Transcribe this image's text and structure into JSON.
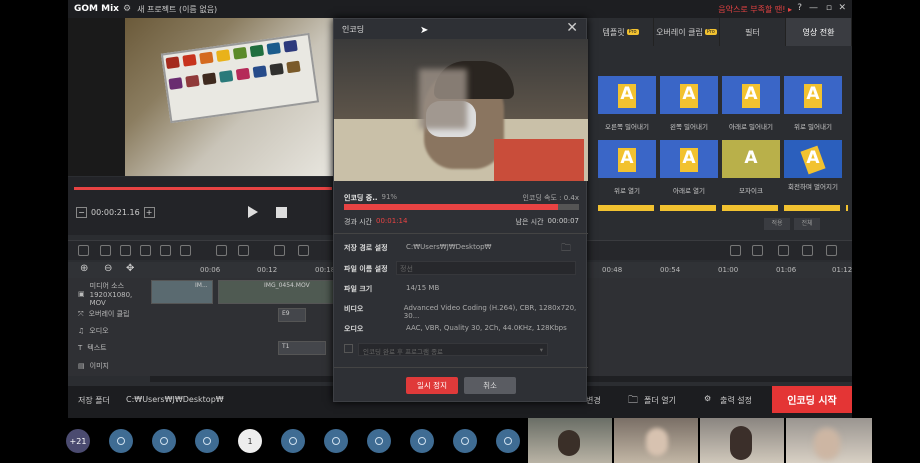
{
  "app": {
    "logo": "GOM Mix",
    "project_title": "새 프로젝트 (이름 없음)",
    "warning": "음악스로 부족할 땐! ▸",
    "help": "?"
  },
  "preview": {
    "timecode": "00:00:21.16",
    "minus": "−",
    "plus": "+"
  },
  "timeline": {
    "ruler_ticks": [
      "00:06",
      "00:12",
      "00:18",
      "00:48",
      "00:54",
      "01:00",
      "01:06",
      "01:12"
    ],
    "tracks": [
      {
        "label": "미디어 소스",
        "sub": "1920X1080, MOV"
      },
      {
        "label": "오버레이 클립",
        "sub": ""
      },
      {
        "label": "오디오",
        "sub": ""
      },
      {
        "label": "텍스트",
        "sub": ""
      },
      {
        "label": "이미지",
        "sub": ""
      }
    ],
    "clips": {
      "media1": "IM...",
      "media2": "IMG_0454.MOV",
      "overlay": "E9",
      "text": "T1"
    }
  },
  "bottom": {
    "save_folder_label": "저장 폴더",
    "save_folder_path": "C:₩Users₩J₩Desktop₩",
    "change": "변경",
    "open_folder": "폴더 열기",
    "output_settings": "출력 설정",
    "start_encoding": "인코딩 시작"
  },
  "right_panel": {
    "tabs": [
      {
        "label": "템플릿",
        "pro": true
      },
      {
        "label": "오버레이 클립",
        "pro": true
      },
      {
        "label": "필터",
        "pro": false
      },
      {
        "label": "영상 전환",
        "pro": false
      }
    ],
    "pro_badge": "Pro",
    "transitions": [
      "오른쪽 밀어내기",
      "왼쪽 밀어내기",
      "아래로 밀어내기",
      "위로 밀어내기",
      "위로 열기",
      "아래로 열기",
      "모자이크",
      "회전하며 멀어지기"
    ],
    "thumb_letter": "A",
    "thumb_sub_letter": "B",
    "apply": "적용",
    "all": "전체"
  },
  "dialog": {
    "title": "인코딩",
    "close": "✕",
    "status_label": "인코딩 중..",
    "percent": "91%",
    "speed_label": "인코딩 속도 : 0.4x",
    "progress": 0.91,
    "elapsed_label": "경과 시간",
    "elapsed_value": "00:01:14",
    "remaining_label": "남은 시간",
    "remaining_value": "00:00:07",
    "save_path_label": "저장 경로 설정",
    "save_path_value": "C:₩Users₩J₩Desktop₩",
    "file_name_label": "파일 이름 설정",
    "file_name_value": "정선",
    "file_size_label": "파일 크기",
    "file_size_value": "14/15 MB",
    "video_label": "비디오",
    "video_value": "Advanced Video Coding (H.264), CBR, 1280x720, 30...",
    "audio_label": "오디오",
    "audio_value": "AAC, VBR, Quality 30, 2Ch, 44.0KHz, 128Kbps",
    "after_encode": "인코딩 완료 후 프로그램 종료",
    "pause": "일시 정지",
    "cancel": "취소"
  },
  "participants": {
    "more": "+21",
    "speaker_number": "1"
  },
  "colors": {
    "accent_red": "#e43535",
    "transition_blue": "#3a66c7",
    "transition_yellow": "#f2c230"
  }
}
